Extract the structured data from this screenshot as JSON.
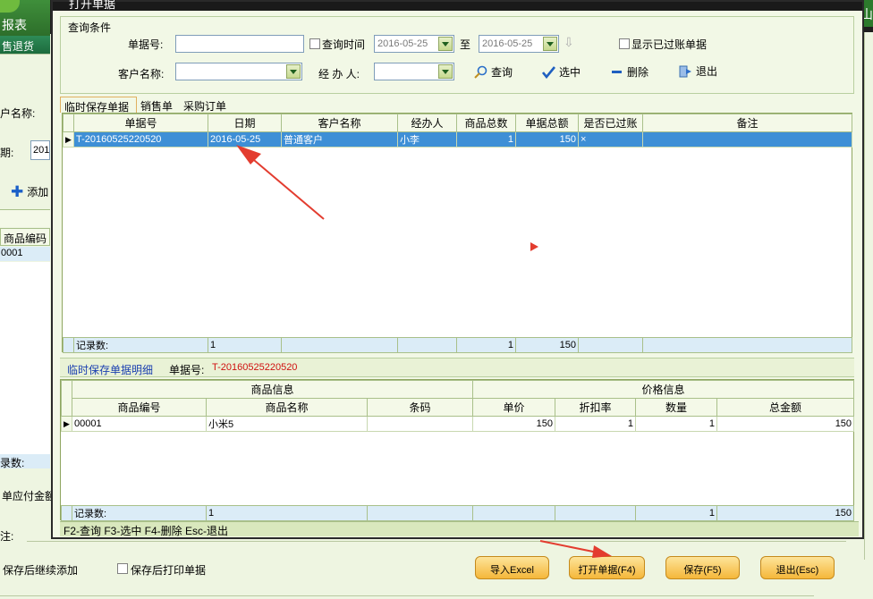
{
  "bg": {
    "logo_text": "报表",
    "tab_label": "售退货",
    "customer_label": "户名称:",
    "date_label": "期:",
    "date_value": "201",
    "add_label": "添加",
    "col_goods_code": "商品编码",
    "row_code": "0001",
    "record_label": "录数:",
    "payable_label": "单应付金额",
    "note_label": "注:",
    "continue_label": "保存后继续添加",
    "print_label": "保存后打印单据",
    "right_tab": "山"
  },
  "dialog": {
    "title": "打开单据",
    "query_group": "查询条件",
    "doc_no_label": "单据号:",
    "doc_no_value": "",
    "query_time_label": "查询时间",
    "date_from": "2016-05-25",
    "to_label": "至",
    "date_to": "2016-05-25",
    "show_posted_label": "显示已过账单据",
    "customer_label": "客户名称:",
    "customer_value": "",
    "handler_label": "经 办 人:",
    "handler_value": "",
    "btn_query": "查询",
    "btn_select": "选中",
    "btn_delete": "删除",
    "btn_exit": "退出",
    "tabs": [
      "临时保存单据",
      "销售单",
      "采购订单"
    ],
    "grid1": {
      "headers": [
        "单据号",
        "日期",
        "客户名称",
        "经办人",
        "商品总数",
        "单据总额",
        "是否已过账",
        "备注"
      ],
      "rows": [
        [
          "T-20160525220520",
          "2016-05-25",
          "普通客户",
          "小李",
          "1",
          "150",
          "×",
          ""
        ]
      ],
      "footer": [
        "记录数:",
        "1",
        "",
        "",
        "1",
        "150",
        "",
        ""
      ]
    },
    "detail_title": "临时保存单据明细",
    "detail_docno_label": "单据号:",
    "detail_docno_value": "T-20160525220520",
    "grid2": {
      "group_goods": "商品信息",
      "group_price": "价格信息",
      "headers": [
        "商品编号",
        "商品名称",
        "条码",
        "单价",
        "折扣率",
        "数量",
        "总金额"
      ],
      "rows": [
        [
          "00001",
          "小米5",
          "",
          "150",
          "1",
          "1",
          "150"
        ]
      ],
      "footer": [
        "记录数:",
        "1",
        "",
        "",
        "",
        "1",
        "150"
      ]
    },
    "status_bar": "F2-查询 F3-选中 F4-删除 Esc-退出"
  },
  "bottom_buttons": {
    "import_excel": "导入Excel",
    "open_doc": "打开单据(F4)",
    "save": "保存(F5)",
    "exit": "退出(Esc)"
  },
  "colors": {
    "selection": "#3e8fd6",
    "arrow": "#e33c2f",
    "button": "#f5b73a"
  }
}
